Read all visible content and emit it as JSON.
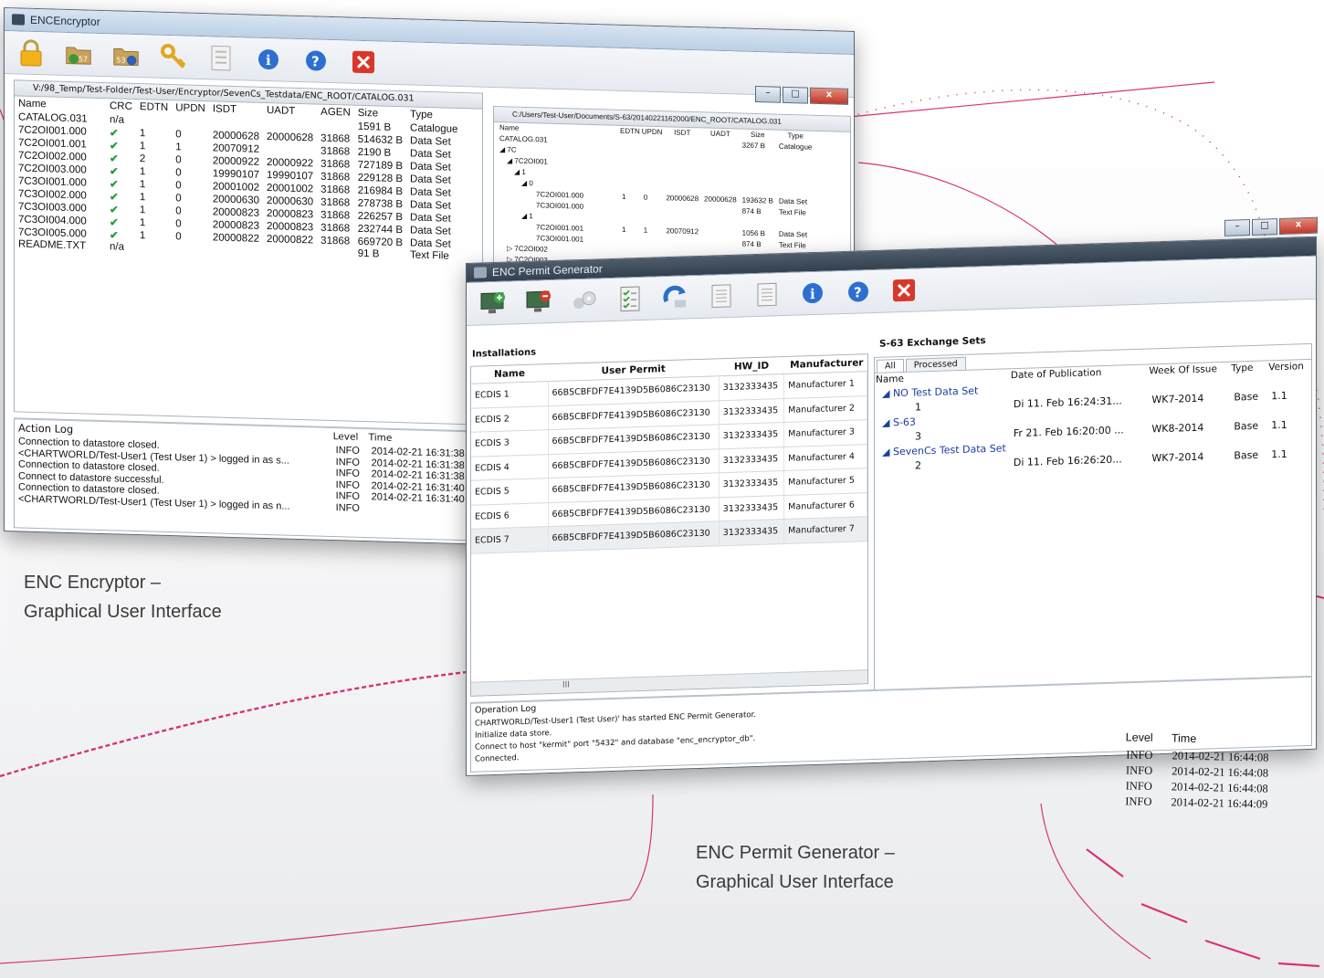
{
  "encryptor": {
    "title": "ENCEncryptor",
    "toolbar_icons": [
      "lock-icon",
      "folder-import-icon",
      "folder-export-icon",
      "key-icon",
      "checklist-icon",
      "info-icon",
      "help-icon",
      "close-icon"
    ],
    "folder_badge_1": "57",
    "folder_badge_2": "53",
    "left_path": "V:/98_Temp/Test-Folder/Test-User/Encryptor/SevenCs_Testdata/ENC_ROOT/CATALOG.031",
    "right_path": "C:/Users/Test-User/Documents/S-63/20140221162000/ENC_ROOT/CATALOG.031",
    "left_columns": [
      "Name",
      "CRC",
      "EDTN",
      "UPDN",
      "ISDT",
      "UADT",
      "AGEN",
      "Size",
      "Type"
    ],
    "left_rows": [
      {
        "name": "CATALOG.031",
        "crc": "n/a",
        "edtn": "",
        "updn": "",
        "isdt": "",
        "uadt": "",
        "agen": "",
        "size": "1591 B",
        "type": "Catalogue"
      },
      {
        "name": "7C2OI001.000",
        "crc": "✔",
        "edtn": "1",
        "updn": "0",
        "isdt": "20000628",
        "uadt": "20000628",
        "agen": "31868",
        "size": "514632 B",
        "type": "Data Set"
      },
      {
        "name": "7C2OI001.001",
        "crc": "✔",
        "edtn": "1",
        "updn": "1",
        "isdt": "20070912",
        "uadt": "",
        "agen": "31868",
        "size": "2190 B",
        "type": "Data Set"
      },
      {
        "name": "7C2OI002.000",
        "crc": "✔",
        "edtn": "2",
        "updn": "0",
        "isdt": "20000922",
        "uadt": "20000922",
        "agen": "31868",
        "size": "727189 B",
        "type": "Data Set"
      },
      {
        "name": "7C2OI003.000",
        "crc": "✔",
        "edtn": "1",
        "updn": "0",
        "isdt": "19990107",
        "uadt": "19990107",
        "agen": "31868",
        "size": "229128 B",
        "type": "Data Set"
      },
      {
        "name": "7C3OI001.000",
        "crc": "✔",
        "edtn": "1",
        "updn": "0",
        "isdt": "20001002",
        "uadt": "20001002",
        "agen": "31868",
        "size": "216984 B",
        "type": "Data Set"
      },
      {
        "name": "7C3OI002.000",
        "crc": "✔",
        "edtn": "1",
        "updn": "0",
        "isdt": "20000630",
        "uadt": "20000630",
        "agen": "31868",
        "size": "278738 B",
        "type": "Data Set"
      },
      {
        "name": "7C3OI003.000",
        "crc": "✔",
        "edtn": "1",
        "updn": "0",
        "isdt": "20000823",
        "uadt": "20000823",
        "agen": "31868",
        "size": "226257 B",
        "type": "Data Set"
      },
      {
        "name": "7C3OI004.000",
        "crc": "✔",
        "edtn": "1",
        "updn": "0",
        "isdt": "20000823",
        "uadt": "20000823",
        "agen": "31868",
        "size": "232744 B",
        "type": "Data Set"
      },
      {
        "name": "7C3OI005.000",
        "crc": "✔",
        "edtn": "1",
        "updn": "0",
        "isdt": "20000822",
        "uadt": "20000822",
        "agen": "31868",
        "size": "669720 B",
        "type": "Data Set"
      },
      {
        "name": "README.TXT",
        "crc": "n/a",
        "edtn": "",
        "updn": "",
        "isdt": "",
        "uadt": "",
        "agen": "",
        "size": "91 B",
        "type": "Text File"
      }
    ],
    "right_columns": [
      "Name",
      "EDTN",
      "UPDN",
      "ISDT",
      "UADT",
      "Size",
      "Type"
    ],
    "right_rows": [
      {
        "name": "CATALOG.031",
        "edtn": "",
        "updn": "",
        "isdt": "",
        "uadt": "",
        "size": "3267 B",
        "type": "Catalogue"
      },
      {
        "name": "◢ 7C",
        "edtn": "",
        "updn": "",
        "isdt": "",
        "uadt": "",
        "size": "",
        "type": ""
      },
      {
        "name": "◢ 7C2OI001",
        "edtn": "",
        "updn": "",
        "isdt": "",
        "uadt": "",
        "size": "",
        "type": ""
      },
      {
        "name": "◢ 1",
        "edtn": "",
        "updn": "",
        "isdt": "",
        "uadt": "",
        "size": "",
        "type": ""
      },
      {
        "name": "◢ 0",
        "edtn": "",
        "updn": "",
        "isdt": "",
        "uadt": "",
        "size": "",
        "type": ""
      },
      {
        "name": "7C2OI001.000",
        "edtn": "1",
        "updn": "0",
        "isdt": "20000628",
        "uadt": "20000628",
        "size": "193632 B",
        "type": "Data Set"
      },
      {
        "name": "7C3OI001.000",
        "edtn": "",
        "updn": "",
        "isdt": "",
        "uadt": "",
        "size": "874 B",
        "type": "Text File"
      },
      {
        "name": "◢ 1",
        "edtn": "",
        "updn": "",
        "isdt": "",
        "uadt": "",
        "size": "",
        "type": ""
      },
      {
        "name": "7C2OI001.001",
        "edtn": "1",
        "updn": "1",
        "isdt": "20070912",
        "uadt": "",
        "size": "1056 B",
        "type": "Data Set"
      },
      {
        "name": "7C3OI001.001",
        "edtn": "",
        "updn": "",
        "isdt": "",
        "uadt": "",
        "size": "874 B",
        "type": "Text File"
      },
      {
        "name": "▷ 7C2OI002",
        "edtn": "",
        "updn": "",
        "isdt": "",
        "uadt": "",
        "size": "",
        "type": ""
      },
      {
        "name": "▷ 7C2OI003",
        "edtn": "",
        "updn": "",
        "isdt": "",
        "uadt": "",
        "size": "",
        "type": ""
      },
      {
        "name": "▷ 7C3OI001",
        "edtn": "",
        "updn": "",
        "isdt": "",
        "uadt": "",
        "size": "",
        "type": ""
      }
    ],
    "log_title": "Action Log",
    "log_columns": [
      "Level",
      "Time"
    ],
    "log_rows": [
      {
        "message": "Connection to datastore closed.",
        "level": "INFO",
        "time": "2014-02-21 16:31:38"
      },
      {
        "message": "<CHARTWORLD/Test-User1 (Test User 1) > logged in as s...",
        "level": "INFO",
        "time": "2014-02-21 16:31:38"
      },
      {
        "message": "Connection to datastore closed.",
        "level": "INFO",
        "time": "2014-02-21 16:31:38"
      },
      {
        "message": "Connect to datastore successful.",
        "level": "INFO",
        "time": "2014-02-21 16:31:40"
      },
      {
        "message": "Connection to datastore closed.",
        "level": "INFO",
        "time": "2014-02-21 16:31:40"
      },
      {
        "message": "<CHARTWORLD/Test-User1 (Test User 1) > logged in as n...",
        "level": "INFO",
        "time": ""
      }
    ]
  },
  "permit": {
    "title": "ENC Permit Generator",
    "toolbar_icons": [
      "add-computer-icon",
      "remove-computer-icon",
      "disabled-discs-icon",
      "checklist-icon",
      "refresh-icon",
      "document-icon",
      "document-icon",
      "info-icon",
      "help-icon",
      "close-icon"
    ],
    "installations_title": "Installations",
    "installations_columns": [
      "Name",
      "User Permit",
      "HW_ID",
      "Manufacturer"
    ],
    "installations_rows": [
      {
        "name": "ECDIS 1",
        "permit": "66B5CBFDF7E4139D5B6086C23130",
        "hwid": "3132333435",
        "manufacturer": "Manufacturer 1"
      },
      {
        "name": "ECDIS 2",
        "permit": "66B5CBFDF7E4139D5B6086C23130",
        "hwid": "3132333435",
        "manufacturer": "Manufacturer 2"
      },
      {
        "name": "ECDIS 3",
        "permit": "66B5CBFDF7E4139D5B6086C23130",
        "hwid": "3132333435",
        "manufacturer": "Manufacturer 3"
      },
      {
        "name": "ECDIS 4",
        "permit": "66B5CBFDF7E4139D5B6086C23130",
        "hwid": "3132333435",
        "manufacturer": "Manufacturer 4"
      },
      {
        "name": "ECDIS 5",
        "permit": "66B5CBFDF7E4139D5B6086C23130",
        "hwid": "3132333435",
        "manufacturer": "Manufacturer 5"
      },
      {
        "name": "ECDIS 6",
        "permit": "66B5CBFDF7E4139D5B6086C23130",
        "hwid": "3132333435",
        "manufacturer": "Manufacturer 6"
      },
      {
        "name": "ECDIS 7",
        "permit": "66B5CBFDF7E4139D5B6086C23130",
        "hwid": "3132333435",
        "manufacturer": "Manufacturer 7"
      }
    ],
    "exchange_title": "S-63 Exchange Sets",
    "tabs": [
      "All",
      "Processed"
    ],
    "exchange_columns": [
      "Name",
      "Date of Publication",
      "Week Of Issue",
      "Type",
      "Version"
    ],
    "exchange_rows": [
      {
        "name": "◢ NO Test Data Set",
        "node": true,
        "date": "",
        "week": "",
        "type": "",
        "version": ""
      },
      {
        "name": "1",
        "node": false,
        "date": "Di 11. Feb 16:24:31...",
        "week": "WK7-2014",
        "type": "Base",
        "version": "1.1"
      },
      {
        "name": "◢ S-63",
        "node": true,
        "date": "",
        "week": "",
        "type": "",
        "version": ""
      },
      {
        "name": "3",
        "node": false,
        "date": "Fr 21. Feb 16:20:00 ...",
        "week": "WK8-2014",
        "type": "Base",
        "version": "1.1"
      },
      {
        "name": "◢ SevenCs Test Data Set",
        "node": true,
        "date": "",
        "week": "",
        "type": "",
        "version": ""
      },
      {
        "name": "2",
        "node": false,
        "date": "Di 11. Feb 16:26:20...",
        "week": "WK7-2014",
        "type": "Base",
        "version": "1.1"
      }
    ],
    "scroll_marker": "III",
    "oplog_title": "Operation Log",
    "oplog_lines": [
      "CHARTWORLD/Test-User1 (Test User)'   has started ENC Permit Generator.",
      "Initialize data store.",
      "Connect to host \"kermit\" port \"5432\" and database \"enc_encryptor_db\".",
      "Connected."
    ],
    "oplog_columns": [
      "Level",
      "Time"
    ],
    "oplog_rows": [
      {
        "level": "INFO",
        "time": "2014-02-21 16:44:08"
      },
      {
        "level": "INFO",
        "time": "2014-02-21 16:44:08"
      },
      {
        "level": "INFO",
        "time": "2014-02-21 16:44:08"
      },
      {
        "level": "INFO",
        "time": "2014-02-21 16:44:09"
      }
    ]
  },
  "captions": {
    "encryptor": [
      "ENC Encryptor –",
      "Graphical User Interface"
    ],
    "permit": [
      "ENC Permit Generator –",
      "Graphical User Interface"
    ]
  },
  "colors": {
    "accent_dashes": "#d8327a",
    "check": "#2a9a3a",
    "tree_node": "#1a3fa0"
  }
}
